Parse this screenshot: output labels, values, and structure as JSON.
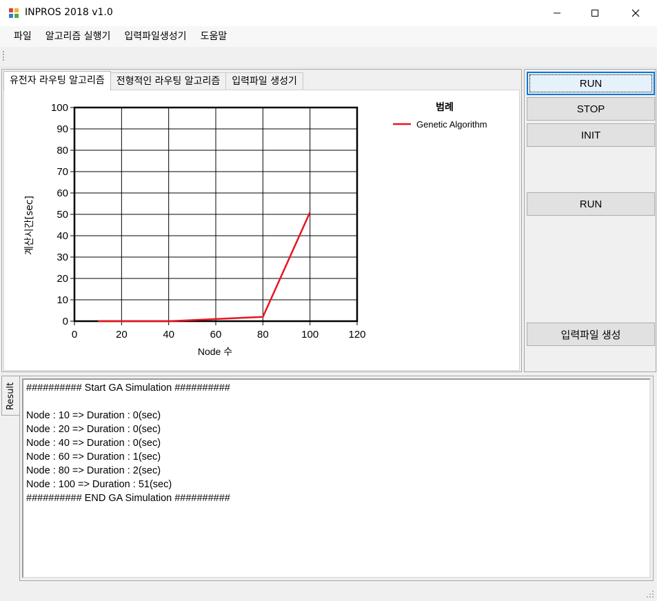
{
  "window": {
    "title": "INPROS 2018 v1.0",
    "icon": "app-icon",
    "controls": [
      "minimize-icon",
      "maximize-icon",
      "close-icon"
    ]
  },
  "menu": {
    "items": [
      {
        "label": "파일"
      },
      {
        "label": "알고리즘 실행기"
      },
      {
        "label": "입력파일생성기"
      },
      {
        "label": "도움말"
      }
    ]
  },
  "tabs": [
    {
      "label": "유전자 라우팅 알고리즘",
      "active": true
    },
    {
      "label": "전형적인 라우팅 알고리즘",
      "active": false
    },
    {
      "label": "입력파일 생성기",
      "active": false
    }
  ],
  "buttons": {
    "run": "RUN",
    "stop": "STOP",
    "init": "INIT",
    "run2": "RUN",
    "generate": "입력파일 생성"
  },
  "chart_data": {
    "type": "line",
    "title": "",
    "xlabel": "Node 수",
    "ylabel": "계산시간[sec]",
    "xlim": [
      0,
      120
    ],
    "ylim": [
      0,
      100
    ],
    "xticks": [
      0,
      20,
      40,
      60,
      80,
      100,
      120
    ],
    "yticks": [
      0,
      10,
      20,
      30,
      40,
      50,
      60,
      70,
      80,
      90,
      100
    ],
    "grid": true,
    "legend": {
      "title": "범례",
      "placement": "top-right"
    },
    "series": [
      {
        "name": "Genetic Algorithm",
        "color": "#e8141c",
        "x": [
          10,
          20,
          40,
          60,
          80,
          100
        ],
        "y": [
          0,
          0,
          0,
          1,
          2,
          51
        ]
      }
    ]
  },
  "result": {
    "tab_label": "Result",
    "lines": [
      "########## Start GA Simulation ##########",
      "",
      "Node : 10 => Duration : 0(sec)",
      "Node : 20 => Duration : 0(sec)",
      "Node : 40 => Duration : 0(sec)",
      "Node : 60 => Duration : 1(sec)",
      "Node : 80 => Duration : 2(sec)",
      "Node : 100 => Duration : 51(sec)",
      "########## END GA Simulation ##########"
    ]
  }
}
